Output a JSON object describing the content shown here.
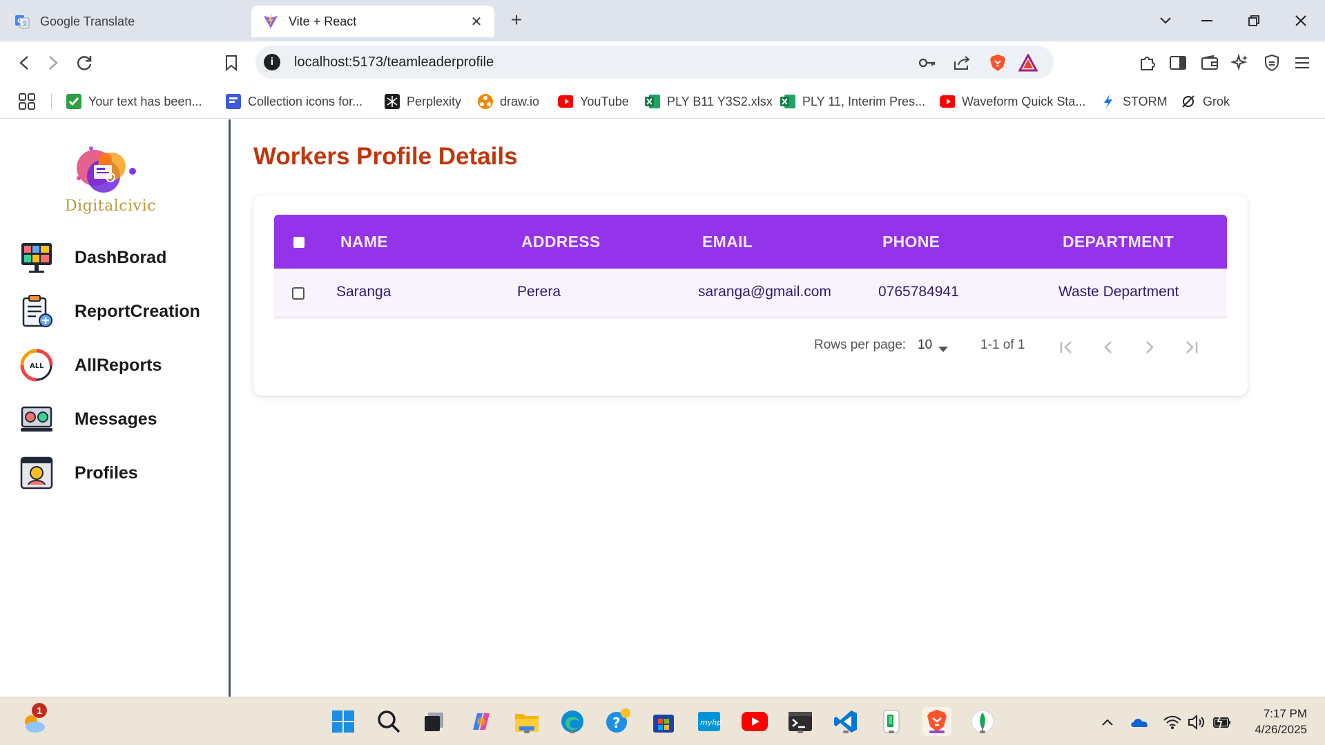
{
  "browser": {
    "tabs": [
      {
        "label": "Google Translate",
        "active": false
      },
      {
        "label": "Vite + React",
        "active": true
      }
    ],
    "url": "localhost:5173/teamleaderprofile",
    "bookmarks": [
      {
        "label": "Your text has been...",
        "icon": "check-icon"
      },
      {
        "label": "Collection icons for...",
        "icon": "collection-icon"
      },
      {
        "label": "Perplexity",
        "icon": "perplexity-icon"
      },
      {
        "label": "draw.io",
        "icon": "drawio-icon"
      },
      {
        "label": "YouTube",
        "icon": "youtube-icon"
      },
      {
        "label": "PLY B11 Y3S2.xlsx",
        "icon": "excel-icon"
      },
      {
        "label": "PLY 11, Interim Pres...",
        "icon": "excel-icon"
      },
      {
        "label": "Waveform Quick Sta...",
        "icon": "youtube-icon"
      },
      {
        "label": "STORM",
        "icon": "storm-icon"
      },
      {
        "label": "Grok",
        "icon": "grok-icon"
      }
    ]
  },
  "sidebar": {
    "logo_text": "Digitalcivic",
    "items": [
      {
        "label": "DashBorad",
        "icon": "dashboard-icon"
      },
      {
        "label": "ReportCreation",
        "icon": "report-creation-icon"
      },
      {
        "label": "AllReports",
        "icon": "all-reports-icon"
      },
      {
        "label": "Messages",
        "icon": "messages-icon"
      },
      {
        "label": "Profiles",
        "icon": "profiles-icon"
      }
    ]
  },
  "main": {
    "title": "Workers Profile Details",
    "table": {
      "columns": [
        "NAME",
        "ADDRESS",
        "EMAIL",
        "PHONE",
        "DEPARTMENT"
      ],
      "rows": [
        {
          "name": "Saranga",
          "address": "Perera",
          "email": "saranga@gmail.com",
          "phone": "0765784941",
          "department": "Waste Department"
        }
      ]
    },
    "pagination": {
      "rows_per_page_label": "Rows per page:",
      "rows_per_page_value": "10",
      "range_text": "1-1 of 1"
    }
  },
  "taskbar": {
    "weather_badge": "1",
    "time": "7:17 PM",
    "date": "4/26/2025"
  },
  "colors": {
    "title": "#c0360c",
    "table_header": "#9333ea",
    "row_bg": "#f8f3fc",
    "row_text": "#2d1a6b"
  }
}
